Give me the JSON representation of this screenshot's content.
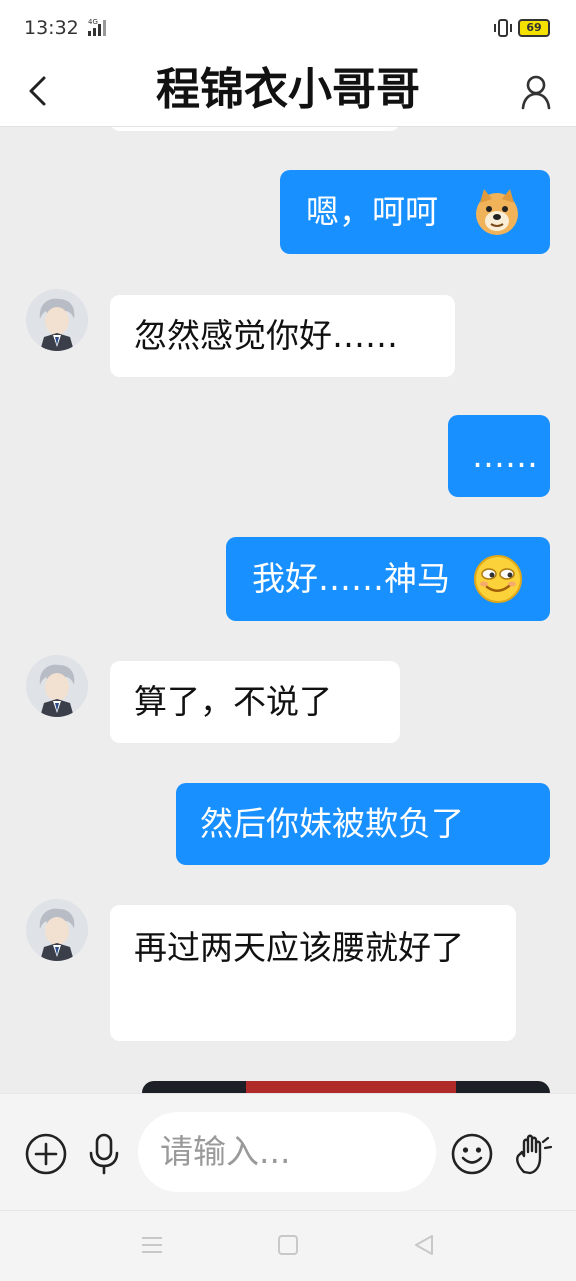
{
  "status_bar": {
    "time": "13:32",
    "network": "4G",
    "battery": "69"
  },
  "header": {
    "title": "程锦衣小哥哥",
    "back_icon": "chevron-left-icon",
    "profile_icon": "person-icon"
  },
  "messages": [
    {
      "from": "me",
      "text": "嗯，呵呵",
      "emoji": "doge-emoji"
    },
    {
      "from": "them",
      "text": "忽然感觉你好……"
    },
    {
      "from": "me",
      "text": "……"
    },
    {
      "from": "me",
      "text": "我好……神马",
      "emoji": "smirk-emoji"
    },
    {
      "from": "them",
      "text": "算了，不说了"
    },
    {
      "from": "me",
      "text": "然后你妹被欺负了"
    },
    {
      "from": "them",
      "text": "再过两天应该腰就好了"
    }
  ],
  "input": {
    "placeholder": "请输入..."
  },
  "colors": {
    "outgoing_bubble": "#1990ff",
    "incoming_bubble": "#ffffff",
    "background": "#ededed"
  }
}
